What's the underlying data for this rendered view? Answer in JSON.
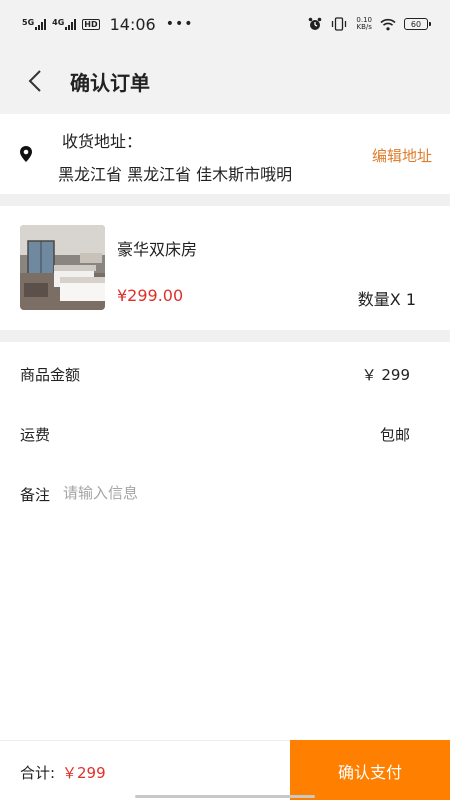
{
  "status_bar": {
    "network_1": "5G",
    "network_2": "4G",
    "hd_label": "HD",
    "time": "14:06",
    "more": "•••",
    "speed_value": "0.10",
    "speed_unit": "KB/s",
    "battery": "60",
    "icons": [
      "alarm-icon",
      "vibrate-icon",
      "wifi-icon",
      "battery-icon"
    ]
  },
  "header": {
    "title": "确认订单",
    "back_icon": "back-chevron-icon"
  },
  "address": {
    "icon": "location-pin-icon",
    "label": "收货地址：",
    "text": "黑龙江省 黑龙江省 佳木斯市哦明",
    "edit_label": "编辑地址"
  },
  "product": {
    "name": "豪华双床房",
    "price": "¥299.00",
    "quantity": "数量X 1",
    "image": "hotel-room-thumbnail"
  },
  "summary": {
    "amount_label": "商品金额",
    "amount_value": "￥ 299",
    "shipping_label": "运费",
    "shipping_value": "包邮",
    "remark_label": "备注",
    "remark_placeholder": "请输入信息"
  },
  "footer": {
    "total_label": "合计:",
    "total_value": "￥299",
    "pay_label": "确认支付"
  },
  "colors": {
    "accent_orange": "#ff7f00",
    "edit_orange": "#e07d2c",
    "price_red": "#e0302b",
    "header_bg": "#f2f2f2"
  }
}
